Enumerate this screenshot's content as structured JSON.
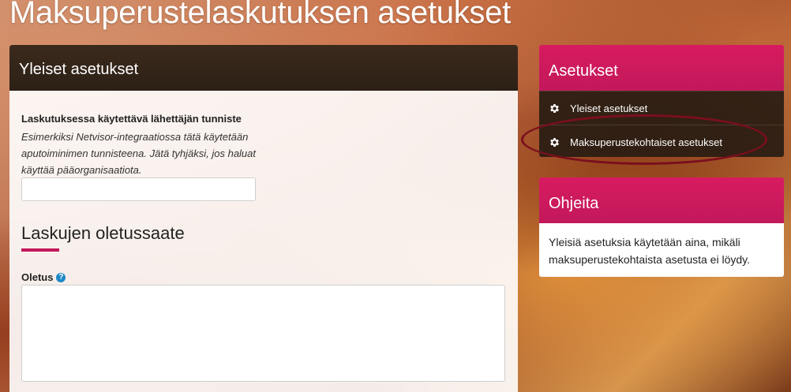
{
  "page": {
    "title": "Maksuperustelaskutuksen asetukset"
  },
  "general_settings": {
    "panel_title": "Yleiset asetukset",
    "sender_id_label": "Laskutuksessa käytettävä lähettäjän tunniste",
    "sender_id_help": "Esimerkiksi Netvisor-integraatiossa tätä käytetään aputoiminimen tunnisteena. Jätä tyhjäksi, jos haluat käyttää pääorganisaatiota.",
    "sender_id_value": "",
    "default_message_heading": "Laskujen oletussaate",
    "default_message_label": "Oletus",
    "help_icon_glyph": "?",
    "default_message_value": ""
  },
  "settings_nav": {
    "title": "Asetukset",
    "items": [
      {
        "label": "Yleiset asetukset",
        "icon": "gear-icon"
      },
      {
        "label": "Maksuperustekohtaiset asetukset",
        "icon": "gear-icon"
      }
    ]
  },
  "help": {
    "title": "Ohjeita",
    "text": "Yleisiä asetuksia käytetään aina, mikäli maksuperustekohtaista asetusta ei löydy."
  },
  "colors": {
    "accent": "#c2185b",
    "header_dark": "#2c2016",
    "annotation": "#7a0f1d",
    "help_icon": "#1e88c8"
  }
}
